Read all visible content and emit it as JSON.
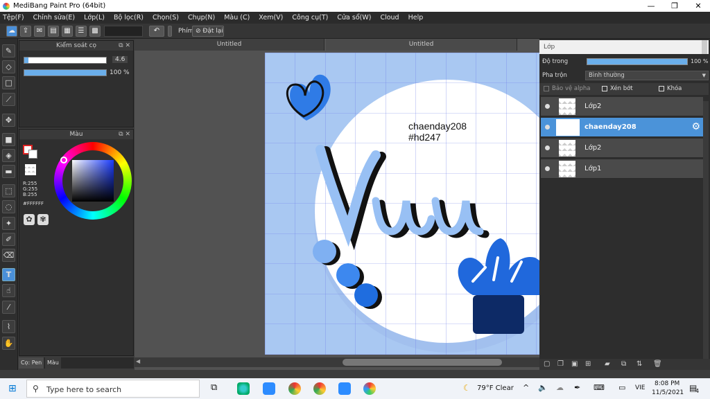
{
  "window": {
    "title": "MediBang Paint Pro (64bit)",
    "minimize": "—",
    "maximize": "❐",
    "close": "✕"
  },
  "menu": [
    "Tệp(F)",
    "Chỉnh sửa(E)",
    "Lớp(L)",
    "Bộ lọc(R)",
    "Chọn(S)",
    "Chụp(N)",
    "Màu (C)",
    "Xem(V)",
    "Công cụ(T)",
    "Cửa sổ(W)",
    "Cloud",
    "Help"
  ],
  "toolbar": {
    "key_label": "Phím",
    "reset_label": "Đặt lại"
  },
  "brush_panel": {
    "title": "Kiểm soát cọ",
    "size_value": "4.6",
    "size_fill": 0.05,
    "opacity_value": "100 %",
    "opacity_fill": 1.0
  },
  "color_panel": {
    "title": "Màu",
    "r": "R:255",
    "g": "G:255",
    "b": "B:255",
    "hex": "#FFFFFF"
  },
  "bottom_tabs": {
    "pen": "Cọ: Pen",
    "color": "Màu"
  },
  "doc_tabs": [
    "Untitled",
    "Untitled"
  ],
  "artwork": {
    "line1": "chaenday208",
    "line2": "#hd247",
    "main_text": "Vu"
  },
  "layers_panel": {
    "title": "Lớp",
    "opacity_label": "Độ trong",
    "opacity_value": "100 %",
    "blend_label": "Pha trộn",
    "blend_value": "Bình thường",
    "protect_alpha": "Bảo vệ alpha",
    "clipping": "Xén bớt",
    "lock": "Khóa",
    "layers": [
      {
        "name": "Lớp2",
        "selected": false
      },
      {
        "name": "chaenday208",
        "selected": true
      },
      {
        "name": "Lớp2",
        "selected": false
      },
      {
        "name": "Lớp1",
        "selected": false
      }
    ]
  },
  "taskbar": {
    "search_placeholder": "Type here to search",
    "weather": "79°F  Clear",
    "lang": "VIE",
    "time": "8:08 PM",
    "date": "11/5/2021",
    "notif_count": "4"
  },
  "colors": {
    "accent": "#4b93d9",
    "canvas_bg": "#a9c8f2",
    "dark_blue": "#0d2a66",
    "mid_blue": "#2b79e0"
  }
}
